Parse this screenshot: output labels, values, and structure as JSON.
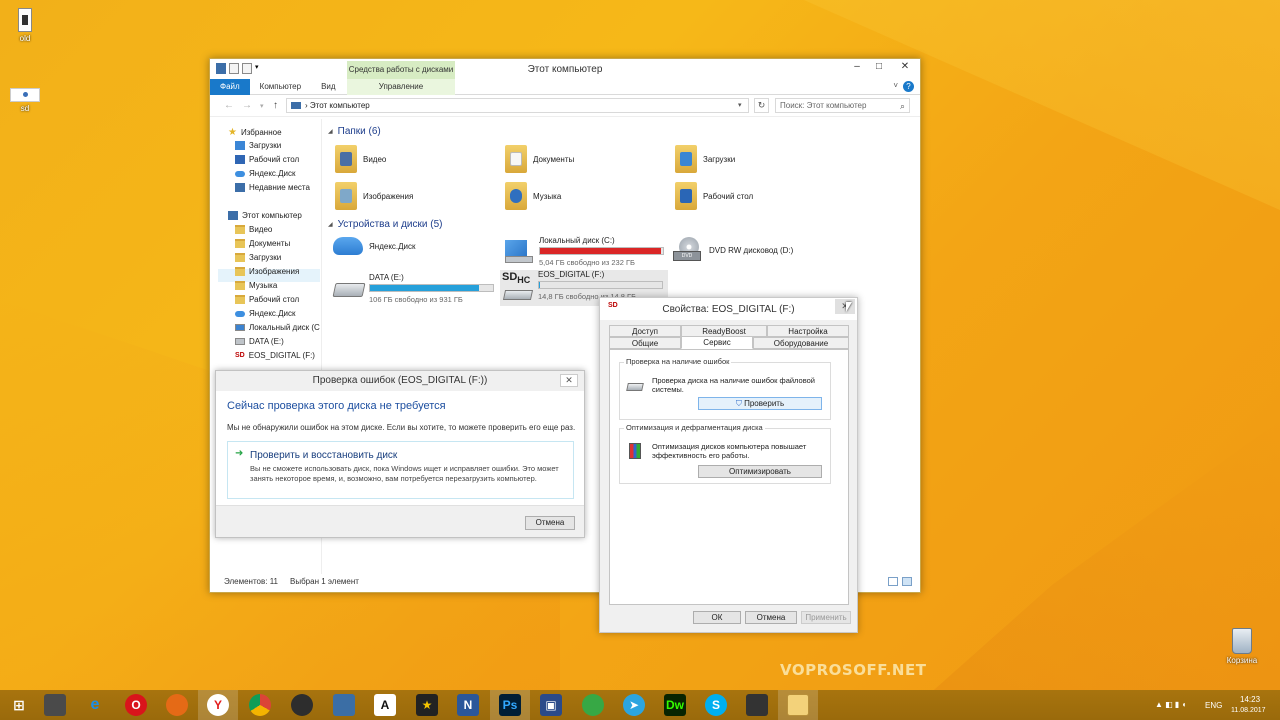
{
  "desktop": {
    "icons": [
      {
        "label": "old"
      },
      {
        "label": "sd"
      },
      {
        "label": "Корзина"
      }
    ],
    "watermark": "VOPROSOFF.NET"
  },
  "explorer": {
    "title": "Этот компьютер",
    "context_tab_header": "Средства работы с дисками",
    "ribbon_tabs": [
      "Файл",
      "Компьютер",
      "Вид"
    ],
    "context_tab": "Управление",
    "address": "Этот компьютер",
    "search_placeholder": "Поиск: Этот компьютер",
    "nav": {
      "favorites": "Избранное",
      "fav_items": [
        "Загрузки",
        "Рабочий стол",
        "Яндекс.Диск",
        "Недавние места"
      ],
      "this_pc": "Этот компьютер",
      "pc_items": [
        "Видео",
        "Документы",
        "Загрузки",
        "Изображения",
        "Музыка",
        "Рабочий стол",
        "Яндекс.Диск",
        "Локальный диск (C",
        "DATA (E:)",
        "EOS_DIGITAL (F:)"
      ]
    },
    "folders_header": "Папки (6)",
    "folders": [
      "Видео",
      "Документы",
      "Загрузки",
      "Изображения",
      "Музыка",
      "Рабочий стол"
    ],
    "devices_header": "Устройства и диски (5)",
    "devices": {
      "yandex": "Яндекс.Диск",
      "c_name": "Локальный диск (C:)",
      "c_free": "5,04 ГБ свободно из 232 ГБ",
      "c_used_fraction": 0.98,
      "dvd": "DVD RW дисковод (D:)",
      "e_name": "DATA (E:)",
      "e_free": "106 ГБ свободно из 931 ГБ",
      "e_used_fraction": 0.89,
      "f_name": "EOS_DIGITAL (F:)",
      "f_free": "14,8 ГБ свободно из 14,8 ГБ",
      "f_used_fraction": 0.01,
      "sd_logo": "SD",
      "sd_logo_hc": "HC"
    },
    "status_items": "Элементов: 11",
    "status_selected": "Выбран 1 элемент"
  },
  "check_dialog": {
    "title": "Проверка ошибок (EOS_DIGITAL (F:))",
    "main_instruction": "Сейчас проверка этого диска не требуется",
    "description": "Мы не обнаружили ошибок на этом диске. Если вы хотите, то можете проверить его еще раз.",
    "command_title": "Проверить и восстановить диск",
    "command_description": "Вы не сможете использовать диск, пока Windows ищет и исправляет ошибки. Это может занять некоторое время, и, возможно, вам потребуется перезагрузить компьютер.",
    "cancel": "Отмена"
  },
  "properties_dialog": {
    "title": "Свойства: EOS_DIGITAL (F:)",
    "tabs_row1": [
      "Доступ",
      "ReadyBoost",
      "Настройка"
    ],
    "tabs_row2": [
      "Общие",
      "Сервис",
      "Оборудование"
    ],
    "group1_label": "Проверка на наличие ошибок",
    "group1_desc": "Проверка диска на наличие ошибок файловой системы.",
    "group1_button": "Проверить",
    "group2_label": "Оптимизация и дефрагментация диска",
    "group2_desc": "Оптимизация дисков компьютера повышает эффективность его работы.",
    "group2_button": "Оптимизировать",
    "ok": "ОК",
    "cancel": "Отмена",
    "apply": "Применить"
  },
  "taskbar": {
    "lang": "ENG",
    "time": "14:23",
    "date": "11.08.2017"
  }
}
